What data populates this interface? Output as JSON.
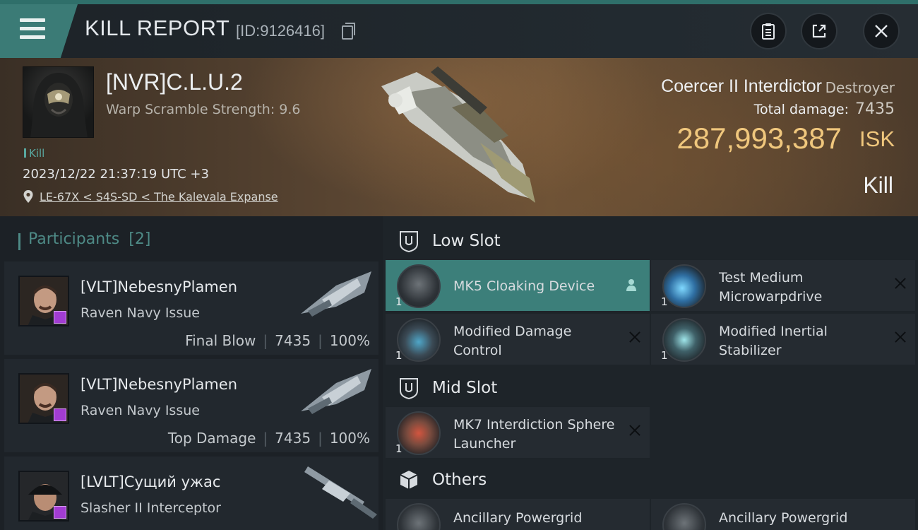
{
  "header": {
    "title": "KILL REPORT",
    "report_id": "[ID:9126416]"
  },
  "victim": {
    "name": "[NVR]C.L.U.2",
    "stat": "Warp Scramble Strength: 9.6",
    "tag": "Kill",
    "datetime": "2023/12/22 21:37:19 UTC +3",
    "location": "LE-67X < S4S-SD < The Kalevala Expanse",
    "ship_name": "Coercer II Interdictor",
    "ship_class": "Destroyer",
    "total_damage_label": "Total damage:",
    "total_damage": "7435",
    "isk_value": "287,993,387",
    "isk_unit": "ISK",
    "outcome": "Kill"
  },
  "participants": {
    "label": "Participants",
    "count": "[2]",
    "rows": [
      {
        "name": "[VLT]NebesnyPlamen",
        "ship": "Raven Navy Issue",
        "role": "Final Blow",
        "damage": "7435",
        "percent": "100%"
      },
      {
        "name": "[VLT]NebesnyPlamen",
        "ship": "Raven Navy Issue",
        "role": "Top Damage",
        "damage": "7435",
        "percent": "100%"
      },
      {
        "name": "[LVLT]Сущий ужас",
        "ship": "Slasher II Interceptor"
      }
    ]
  },
  "slots": {
    "low": {
      "title": "Low Slot",
      "modules": [
        {
          "qty": "1",
          "name": "MK5 Cloaking Device"
        },
        {
          "qty": "1",
          "name": "Test Medium Microwarpdrive"
        },
        {
          "qty": "1",
          "name": "Modified Damage Control"
        },
        {
          "qty": "1",
          "name": "Modified Inertial Stabilizer"
        }
      ]
    },
    "mid": {
      "title": "Mid Slot",
      "modules": [
        {
          "qty": "1",
          "name": "MK7 Interdiction Sphere Launcher"
        }
      ]
    },
    "others": {
      "title": "Others",
      "modules": [
        {
          "name": "Ancillary Powergrid"
        },
        {
          "name": "Ancillary Powergrid"
        }
      ]
    }
  },
  "colors": {
    "accent": "#3c7f7a",
    "isk": "#f0c77d",
    "badge": "#a23cd2"
  }
}
